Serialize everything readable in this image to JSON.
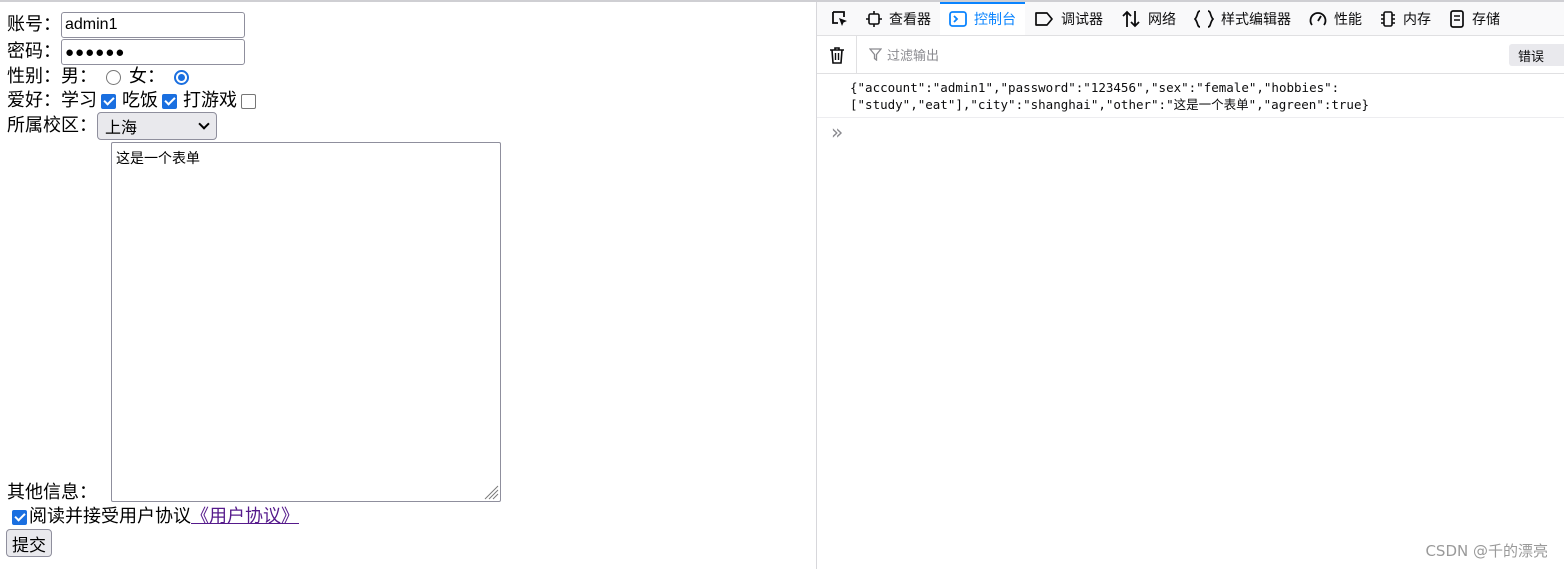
{
  "form": {
    "account_label": "账号：",
    "account_value": "admin1",
    "password_label": "密码：",
    "password_value": "●●●●●●",
    "sex_label": "性别：",
    "male_label": "男：",
    "female_label": "女：",
    "sex_selected": "female",
    "hobby_label": "爱好：",
    "hobbies": [
      {
        "label": "学习",
        "checked": true
      },
      {
        "label": "吃饭",
        "checked": true
      },
      {
        "label": "打游戏",
        "checked": false
      }
    ],
    "campus_label": "所属校区：",
    "campus_value": "上海",
    "other_label": "其他信息：",
    "other_value": "这是一个表单",
    "agree_checked": true,
    "agree_text": "阅读并接受用户协议",
    "agree_link": "《用户协议》",
    "submit_label": "提交"
  },
  "devtools": {
    "tabs": [
      {
        "label": "查看器",
        "icon": "inspector-icon",
        "active": false
      },
      {
        "label": "控制台",
        "icon": "console-icon",
        "active": true
      },
      {
        "label": "调试器",
        "icon": "debugger-icon",
        "active": false
      },
      {
        "label": "网络",
        "icon": "network-icon",
        "active": false
      },
      {
        "label": "样式编辑器",
        "icon": "style-editor-icon",
        "active": false
      },
      {
        "label": "性能",
        "icon": "performance-icon",
        "active": false
      },
      {
        "label": "内存",
        "icon": "memory-icon",
        "active": false
      },
      {
        "label": "存储",
        "icon": "storage-icon",
        "active": false
      }
    ],
    "filter_placeholder": "过滤输出",
    "errors_label": "错误",
    "console_output": [
      "{\"account\":\"admin1\",\"password\":\"123456\",\"sex\":\"female\",\"hobbies\":",
      "[\"study\",\"eat\"],\"city\":\"shanghai\",\"other\":\"这是一个表单\",\"agreen\":true}"
    ],
    "prompt_symbol": "»",
    "accent_color": "#0a84ff"
  },
  "watermark": "CSDN @千的漂亮"
}
